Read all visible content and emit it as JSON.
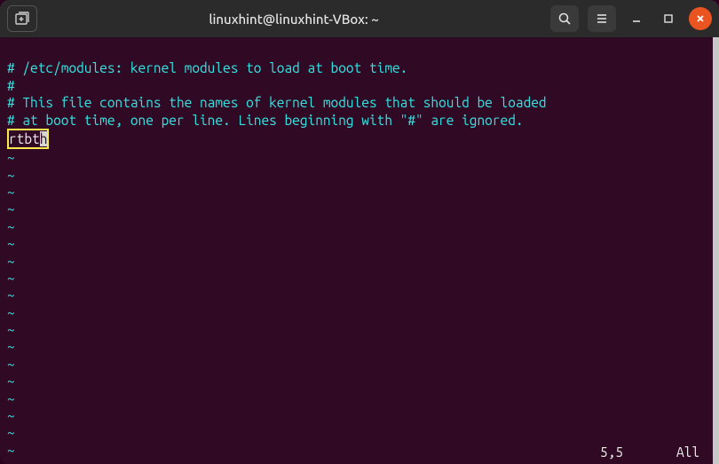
{
  "titlebar": {
    "title": "linuxhint@linuxhint-VBox: ~"
  },
  "editor": {
    "lines": {
      "l1": "# /etc/modules: kernel modules to load at boot time.",
      "l2": "#",
      "l3": "# This file contains the names of kernel modules that should be loaded",
      "l4": "# at boot time, one per line. Lines beginning with \"#\" are ignored.",
      "module_prefix": "rtbt",
      "module_cursor": "h"
    },
    "tilde": "~"
  },
  "status": {
    "position": "5,5",
    "view": "All"
  },
  "icons": {
    "new_tab": "new-tab-icon",
    "search": "search-icon",
    "menu": "hamburger-icon",
    "minimize": "minimize-icon",
    "maximize": "maximize-icon",
    "close": "close-icon"
  }
}
